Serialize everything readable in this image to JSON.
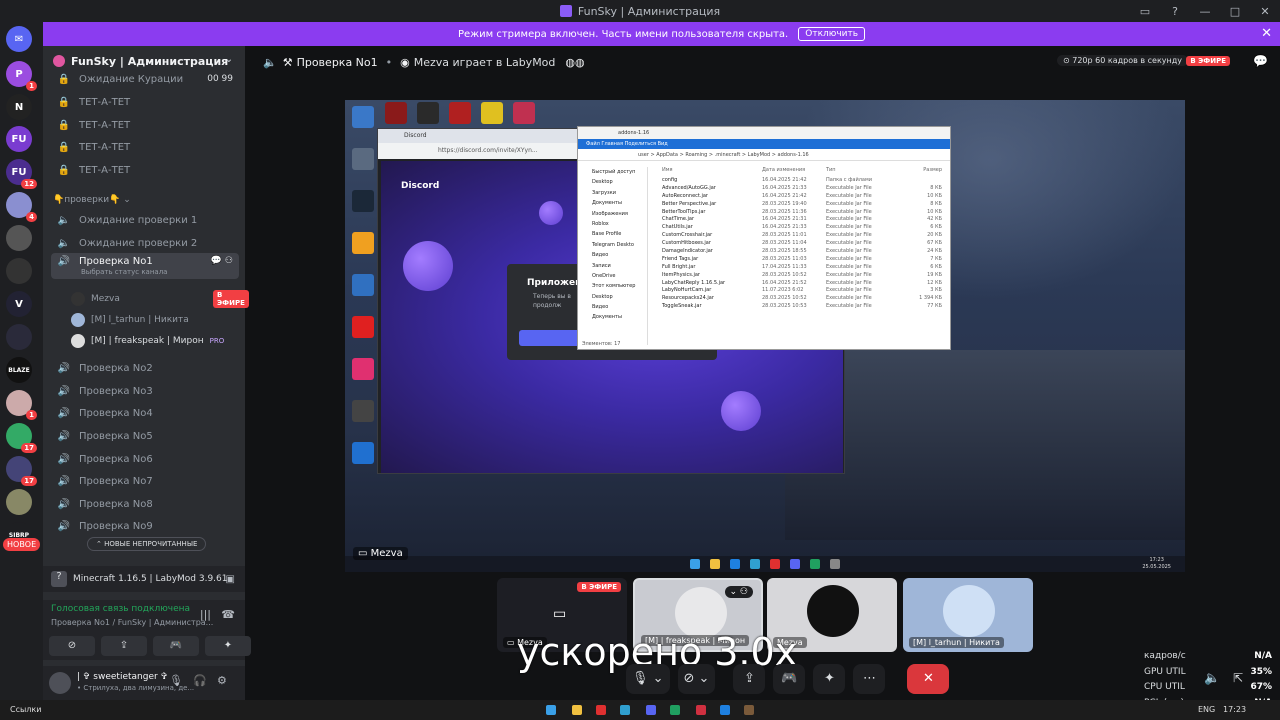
{
  "window": {
    "title": "FunSky | Администрация"
  },
  "banner": {
    "text": "Режим стримера включен. Часть имени пользователя скрыта.",
    "button": "Отключить"
  },
  "rail": {
    "servers": [
      {
        "label": "P",
        "badge": "1",
        "color": "#9b4de0"
      },
      {
        "label": "N",
        "badge": "",
        "color": "#222"
      },
      {
        "label": "FU",
        "badge": "",
        "color": "#7a3cd0"
      },
      {
        "label": "FU",
        "badge": "12",
        "color": "#4b2d8f"
      },
      {
        "label": "",
        "badge": "4",
        "color": "#8a8fd0"
      },
      {
        "label": "",
        "badge": "",
        "color": "#555"
      },
      {
        "label": "",
        "badge": "",
        "color": "#333"
      },
      {
        "label": "V",
        "badge": "",
        "color": "#223"
      },
      {
        "label": "",
        "badge": "",
        "color": "#2a2a3a"
      },
      {
        "label": "BLAZE",
        "badge": "",
        "color": "#111"
      },
      {
        "label": "",
        "badge": "1",
        "color": "#caa"
      },
      {
        "label": "",
        "badge": "17",
        "color": "#3a6"
      },
      {
        "label": "",
        "badge": "17",
        "color": "#447"
      },
      {
        "label": "",
        "badge": "",
        "color": "#886"
      },
      {
        "label": "SIBRP",
        "badge": "",
        "color": "#1e1f22"
      }
    ],
    "new_label": "НОВОЕ"
  },
  "sidebar": {
    "server_name": "FunSky | Администрация",
    "top_channels": [
      {
        "name": "Ожидание Курации",
        "right": "00 99"
      },
      {
        "name": "ТЕТ-А-ТЕТ"
      },
      {
        "name": "ТЕТ-А-ТЕТ"
      },
      {
        "name": "ТЕТ-А-ТЕТ"
      },
      {
        "name": "ТЕТ-А-ТЕТ"
      }
    ],
    "category": "👇проверки👇",
    "wait_channels": [
      "Ожидание проверки 1",
      "Ожидание проверки 2"
    ],
    "active_channel": {
      "name": "Проверка No1",
      "status": "Выбрать статус канала"
    },
    "users": [
      {
        "name": "Mezva",
        "live": "В ЭФИРЕ"
      },
      {
        "name": "[M] l_tarhun | Никита"
      },
      {
        "name": "[M] | freakspeak | Мирон",
        "badge": "PRO"
      }
    ],
    "channels": [
      "Проверка No2",
      "Проверка No3",
      "Проверка No4",
      "Проверка No5",
      "Проверка No6",
      "Проверка No7",
      "Проверка No8",
      "Проверка No9"
    ],
    "unread_pill": "НОВЫЕ НЕПРОЧИТАННЫЕ"
  },
  "activity": {
    "game": "Minecraft 1.16.5 | LabyMod 3.9.61"
  },
  "voice": {
    "status": "Голосовая связь подключена",
    "channel": "Проверка No1 / FunSky | Администра..."
  },
  "userbar": {
    "name": "| ✞ sweetietanger ✞",
    "status": "• Стрилуха, два лимузина, де..."
  },
  "stage": {
    "channel": "Проверка No1",
    "game_text": "Mezva играет в LabyMod",
    "quality": "720р 60 кадров в секунду",
    "live": "В ЭФИРЕ"
  },
  "stream": {
    "name": "Mezva",
    "browser_tab": "Discord",
    "browser_url": "https://discord.com/invite/XYyn...",
    "discord_logo": "Discord",
    "modal_title": "Приложен",
    "modal_sub": "Теперь вы в\nпродолж",
    "explorer_title": "addons-1.16",
    "explorer_ribbon": "Файл   Главная   Поделиться   Вид",
    "explorer_path": "user  >  AppData  >  Roaming  >  .minecraft  >  LabyMod  >  addons-1.16",
    "explorer_nav": [
      "Быстрый доступ",
      "Desktop",
      "Загрузки",
      "Документы",
      "Изображения",
      "Roblox",
      "Base Profile",
      "Telegram Deskto",
      "Видео",
      "Записи",
      "OneDrive",
      "Этот компьютер",
      "Desktop",
      "Видео",
      "Документы"
    ],
    "explorer_headers": [
      "Имя",
      "Дата изменения",
      "Тип",
      "Размер"
    ],
    "files": [
      [
        "config",
        "16.04.2025 21:42",
        "Папка с файлами",
        ""
      ],
      [
        "Advanced/AutoGG.jar",
        "16.04.2025 21:33",
        "Executable Jar File",
        "8 КБ"
      ],
      [
        "AutoReconnect.jar",
        "16.04.2025 21:42",
        "Executable Jar File",
        "10 КБ"
      ],
      [
        "Better Perspective.jar",
        "28.03.2025 19:40",
        "Executable Jar File",
        "8 КБ"
      ],
      [
        "BetterToolTips.jar",
        "28.03.2025 11:36",
        "Executable Jar File",
        "10 КБ"
      ],
      [
        "ChatTime.jar",
        "16.04.2025 21:31",
        "Executable Jar File",
        "42 КБ"
      ],
      [
        "ChatUtils.jar",
        "16.04.2025 21:33",
        "Executable Jar File",
        "6 КБ"
      ],
      [
        "CustomCrosshair.jar",
        "28.03.2025 11:01",
        "Executable Jar File",
        "20 КБ"
      ],
      [
        "CustomHitboxes.jar",
        "28.03.2025 11:04",
        "Executable Jar File",
        "67 КБ"
      ],
      [
        "DamageIndicator.jar",
        "28.03.2025 18:55",
        "Executable Jar File",
        "24 КБ"
      ],
      [
        "Friend Tags.jar",
        "28.03.2025 11:03",
        "Executable Jar File",
        "7 КБ"
      ],
      [
        "Full Bright.jar",
        "17.04.2025 11:33",
        "Executable Jar File",
        "6 КБ"
      ],
      [
        "ItemPhysics.jar",
        "28.03.2025 10:52",
        "Executable Jar File",
        "19 КБ"
      ],
      [
        "LabyChatReply 1.16.5.jar",
        "16.04.2025 21:52",
        "Executable Jar File",
        "12 КБ"
      ],
      [
        "LabyNoHurtCam.jar",
        "11.07.2023 6:02",
        "Executable Jar File",
        "3 КБ"
      ],
      [
        "Resourcepacks24.jar",
        "28.03.2025 10:52",
        "Executable Jar File",
        "1 394 КБ"
      ],
      [
        "ToggleSneak.jar",
        "28.03.2025 10:53",
        "Executable Jar File",
        "77 КБ"
      ]
    ],
    "explorer_footer": "Элементов: 17",
    "clock_time": "17:23",
    "clock_date": "25.05.2025"
  },
  "tiles": [
    {
      "name": "Mezva",
      "live": "В ЭФИРЕ",
      "bg": "#1d1e24"
    },
    {
      "name": "[M] | freakspeak | Мирон",
      "bg": "#c9cbd1"
    },
    {
      "name": "Mezva",
      "bg": "#d7d7da"
    },
    {
      "name": "[M] l_tarhun | Никита",
      "bg": "#9fb6d8"
    }
  ],
  "speed_text": "ускорено 3.0x",
  "stats": [
    {
      "label": "кадров/с",
      "value": "N/A"
    },
    {
      "label": "GPU UTIL",
      "value": "35%"
    },
    {
      "label": "CPU UTIL",
      "value": "67%"
    },
    {
      "label": "PCL (ms)",
      "value": "N/A"
    }
  ],
  "taskbar": {
    "links": "Ссылки",
    "lang": "ENG",
    "time": "17:23"
  }
}
